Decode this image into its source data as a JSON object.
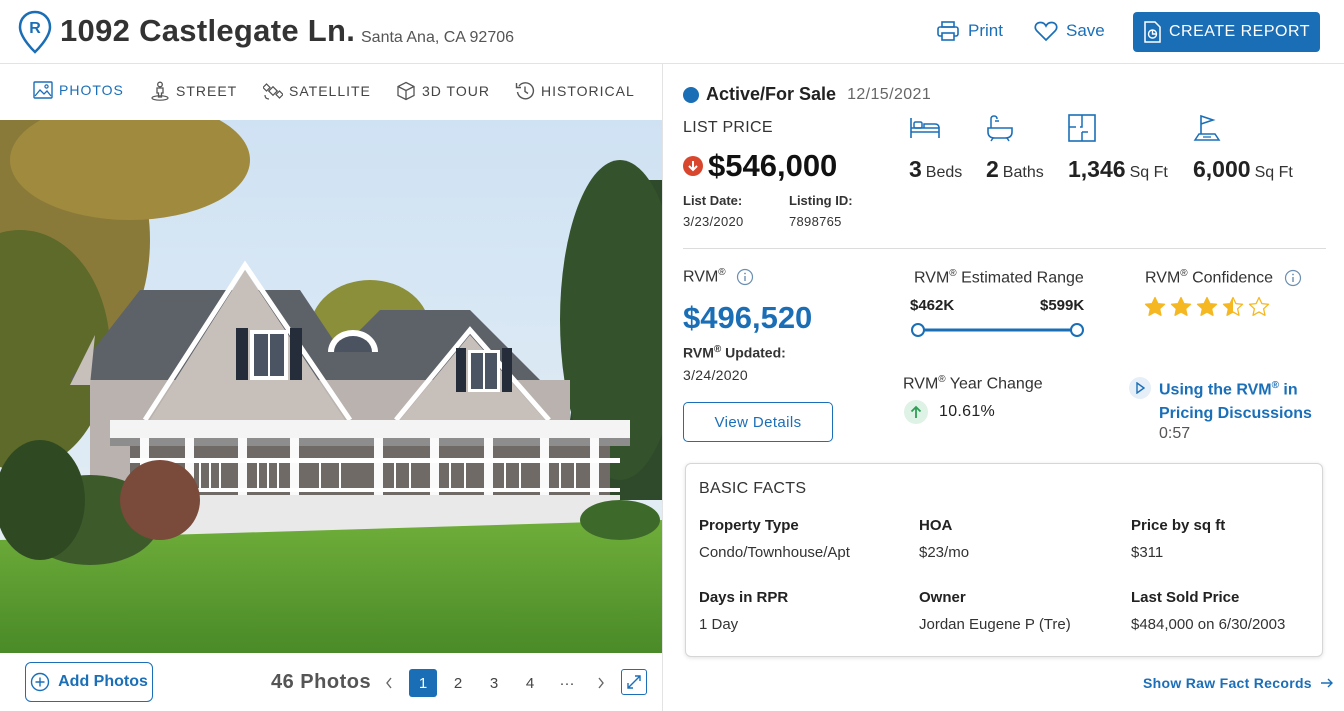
{
  "header": {
    "logo_letter": "R",
    "address": "1092 Castlegate Ln.",
    "city_state_zip": "Santa Ana, CA 92706",
    "print_label": "Print",
    "save_label": "Save",
    "create_report_label": "CREATE REPORT"
  },
  "tabs": [
    {
      "label": "PHOTOS",
      "icon": "photo-icon",
      "active": true
    },
    {
      "label": "STREET",
      "icon": "street-view-icon"
    },
    {
      "label": "SATELLITE",
      "icon": "satellite-icon"
    },
    {
      "label": "3D TOUR",
      "icon": "cube-icon"
    },
    {
      "label": "HISTORICAL",
      "icon": "history-icon"
    }
  ],
  "photos": {
    "add_label": "Add Photos",
    "count_label": "46 Photos",
    "pages": [
      "1",
      "2",
      "3",
      "4",
      "···"
    ],
    "current_page": "1"
  },
  "listing": {
    "status": "Active/For Sale",
    "status_date": "12/15/2021",
    "list_price_label": "LIST PRICE",
    "price": "$546,000",
    "list_date_label": "List Date:",
    "list_date": "3/23/2020",
    "listing_id_label": "Listing ID:",
    "listing_id": "7898765"
  },
  "features": [
    {
      "value": "3",
      "unit": "Beds",
      "icon": "bed-icon"
    },
    {
      "value": "2",
      "unit": "Baths",
      "icon": "bathtub-icon"
    },
    {
      "value": "1,346",
      "unit": "Sq Ft",
      "icon": "floorplan-icon"
    },
    {
      "value": "6,000",
      "unit": "Sq Ft",
      "icon": "lot-flag-icon"
    }
  ],
  "rvm": {
    "label": "RVM",
    "value": "$496,520",
    "updated_label": "Updated:",
    "updated_date": "3/24/2020",
    "range_label": "Estimated Range",
    "range_low": "$462K",
    "range_high": "$599K",
    "confidence_label": "Confidence",
    "confidence_stars": 3.5,
    "year_change_label": "Year Change",
    "year_change_value": "10.61%",
    "view_details_label": "View Details",
    "video_title_a": "Using the RVM",
    "video_title_b": " in Pricing Discussions",
    "video_duration": "0:57",
    "registered": "®"
  },
  "basic_facts": {
    "title": "BASIC FACTS",
    "items": [
      {
        "label": "Property Type",
        "value": "Condo/Townhouse/Apt"
      },
      {
        "label": "HOA",
        "value": "$23/mo"
      },
      {
        "label": "Price by sq ft",
        "value": "$311"
      },
      {
        "label": "Days in RPR",
        "value": "1 Day"
      },
      {
        "label": "Owner",
        "value": "Jordan Eugene P (Tre)"
      },
      {
        "label": "Last Sold Price",
        "value": "$484,000 on 6/30/2003"
      }
    ]
  },
  "raw_facts_label": "Show Raw Fact Records",
  "colors": {
    "accent": "#1a6eb6",
    "price_down": "#d9462e",
    "star": "#f5b823",
    "positive_bg": "#dff2e6",
    "positive": "#2e9e55"
  }
}
